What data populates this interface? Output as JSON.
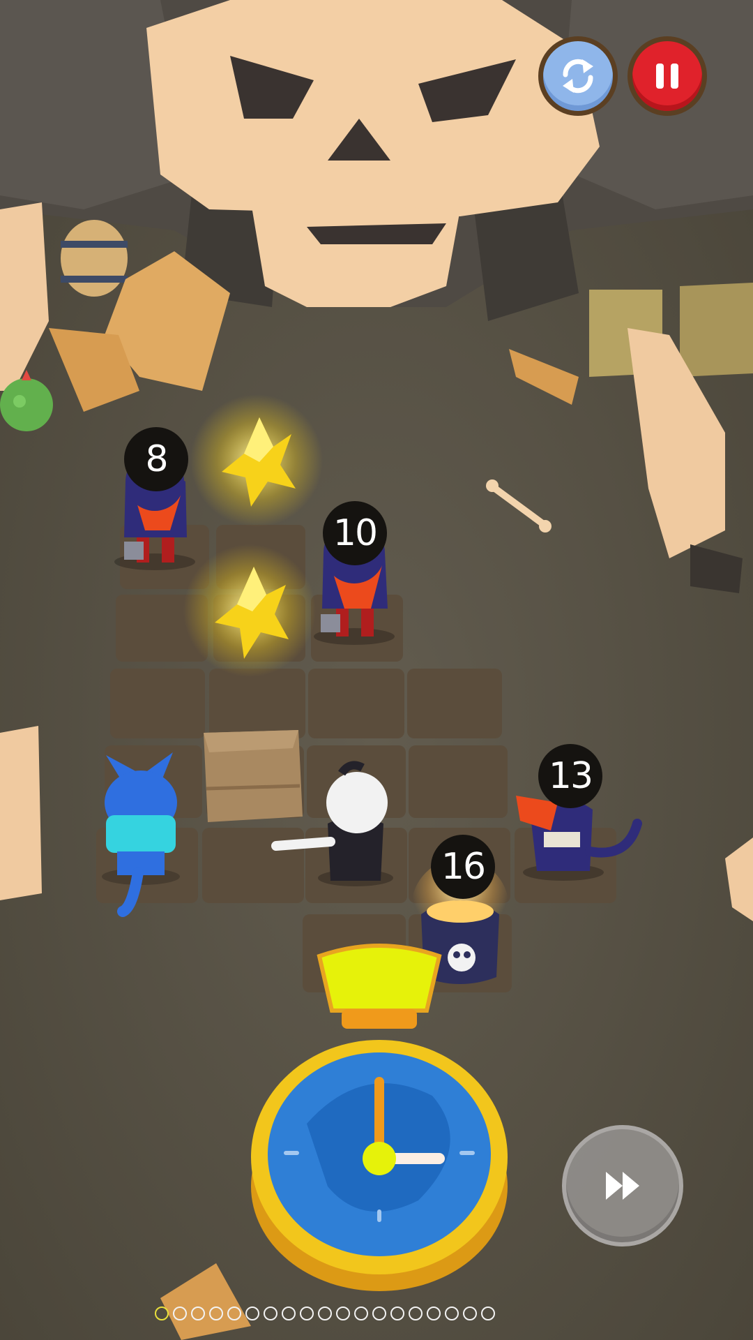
{
  "hud": {
    "restart_icon": "refresh-icon",
    "pause_icon": "pause-icon",
    "fast_forward_icon": "fast-forward-icon"
  },
  "enemies": [
    {
      "turns": "8"
    },
    {
      "turns": "10"
    },
    {
      "turns": "13"
    },
    {
      "turns": "16"
    }
  ],
  "pagination": {
    "total": 19,
    "active_index": 0
  },
  "colors": {
    "pause": "#e0222b",
    "restart": "#8fb6ea",
    "timer_blue": "#2f7fd6",
    "timer_gold": "#f2c61c",
    "timer_lime": "#e6f20a",
    "star": "#f7d21a"
  }
}
